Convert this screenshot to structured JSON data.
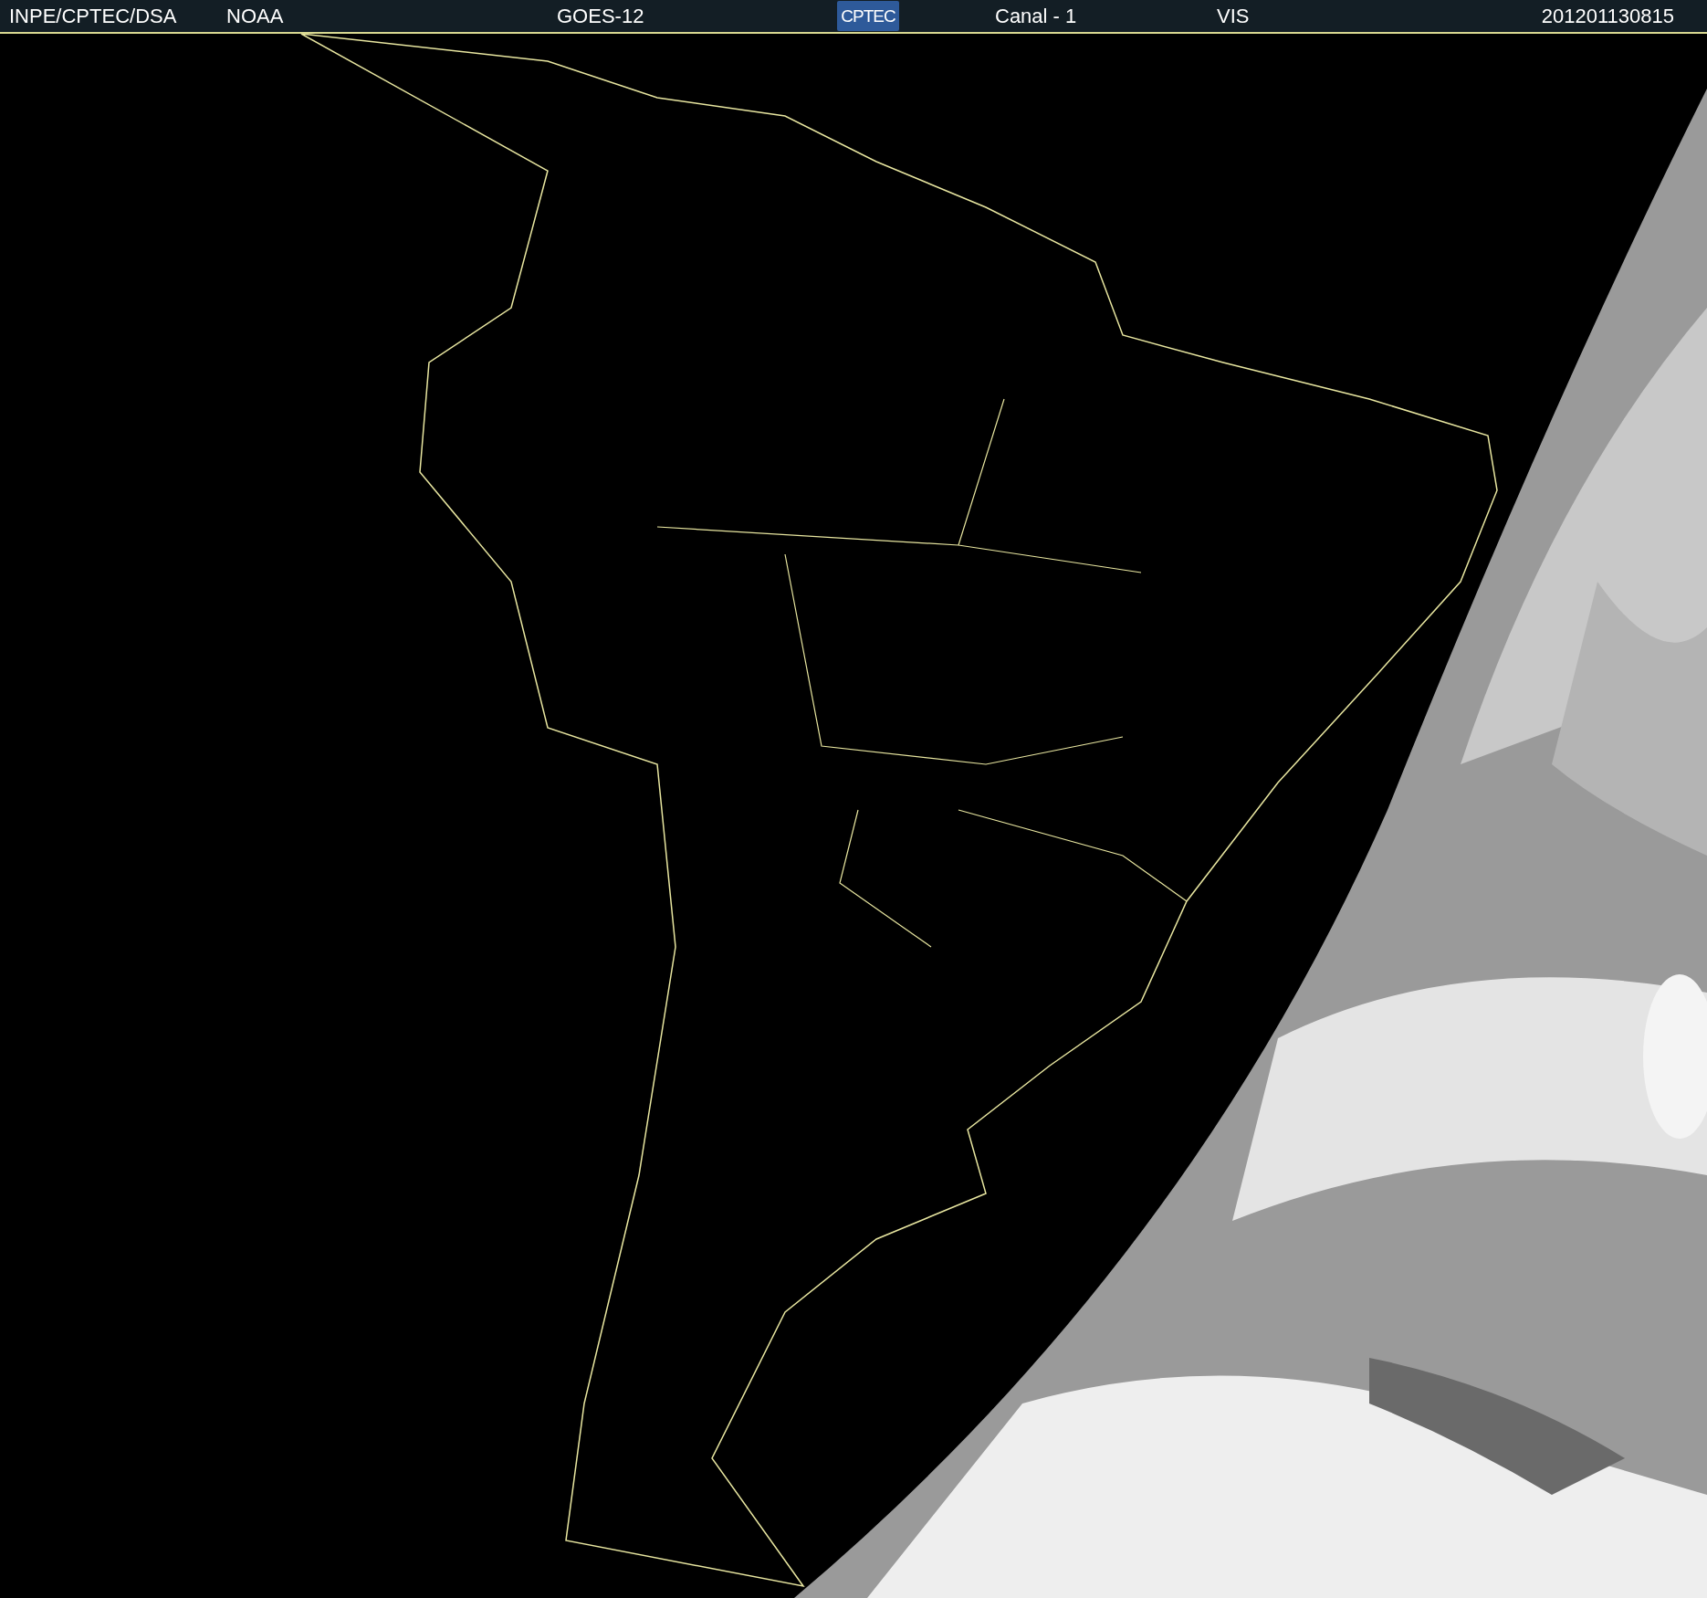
{
  "header": {
    "source": "INPE/CPTEC/DSA",
    "agency": "NOAA",
    "satellite": "GOES-12",
    "logo": "CPTEC",
    "channel": "Canal - 1",
    "band": "VIS",
    "timestamp": "201201130815"
  }
}
